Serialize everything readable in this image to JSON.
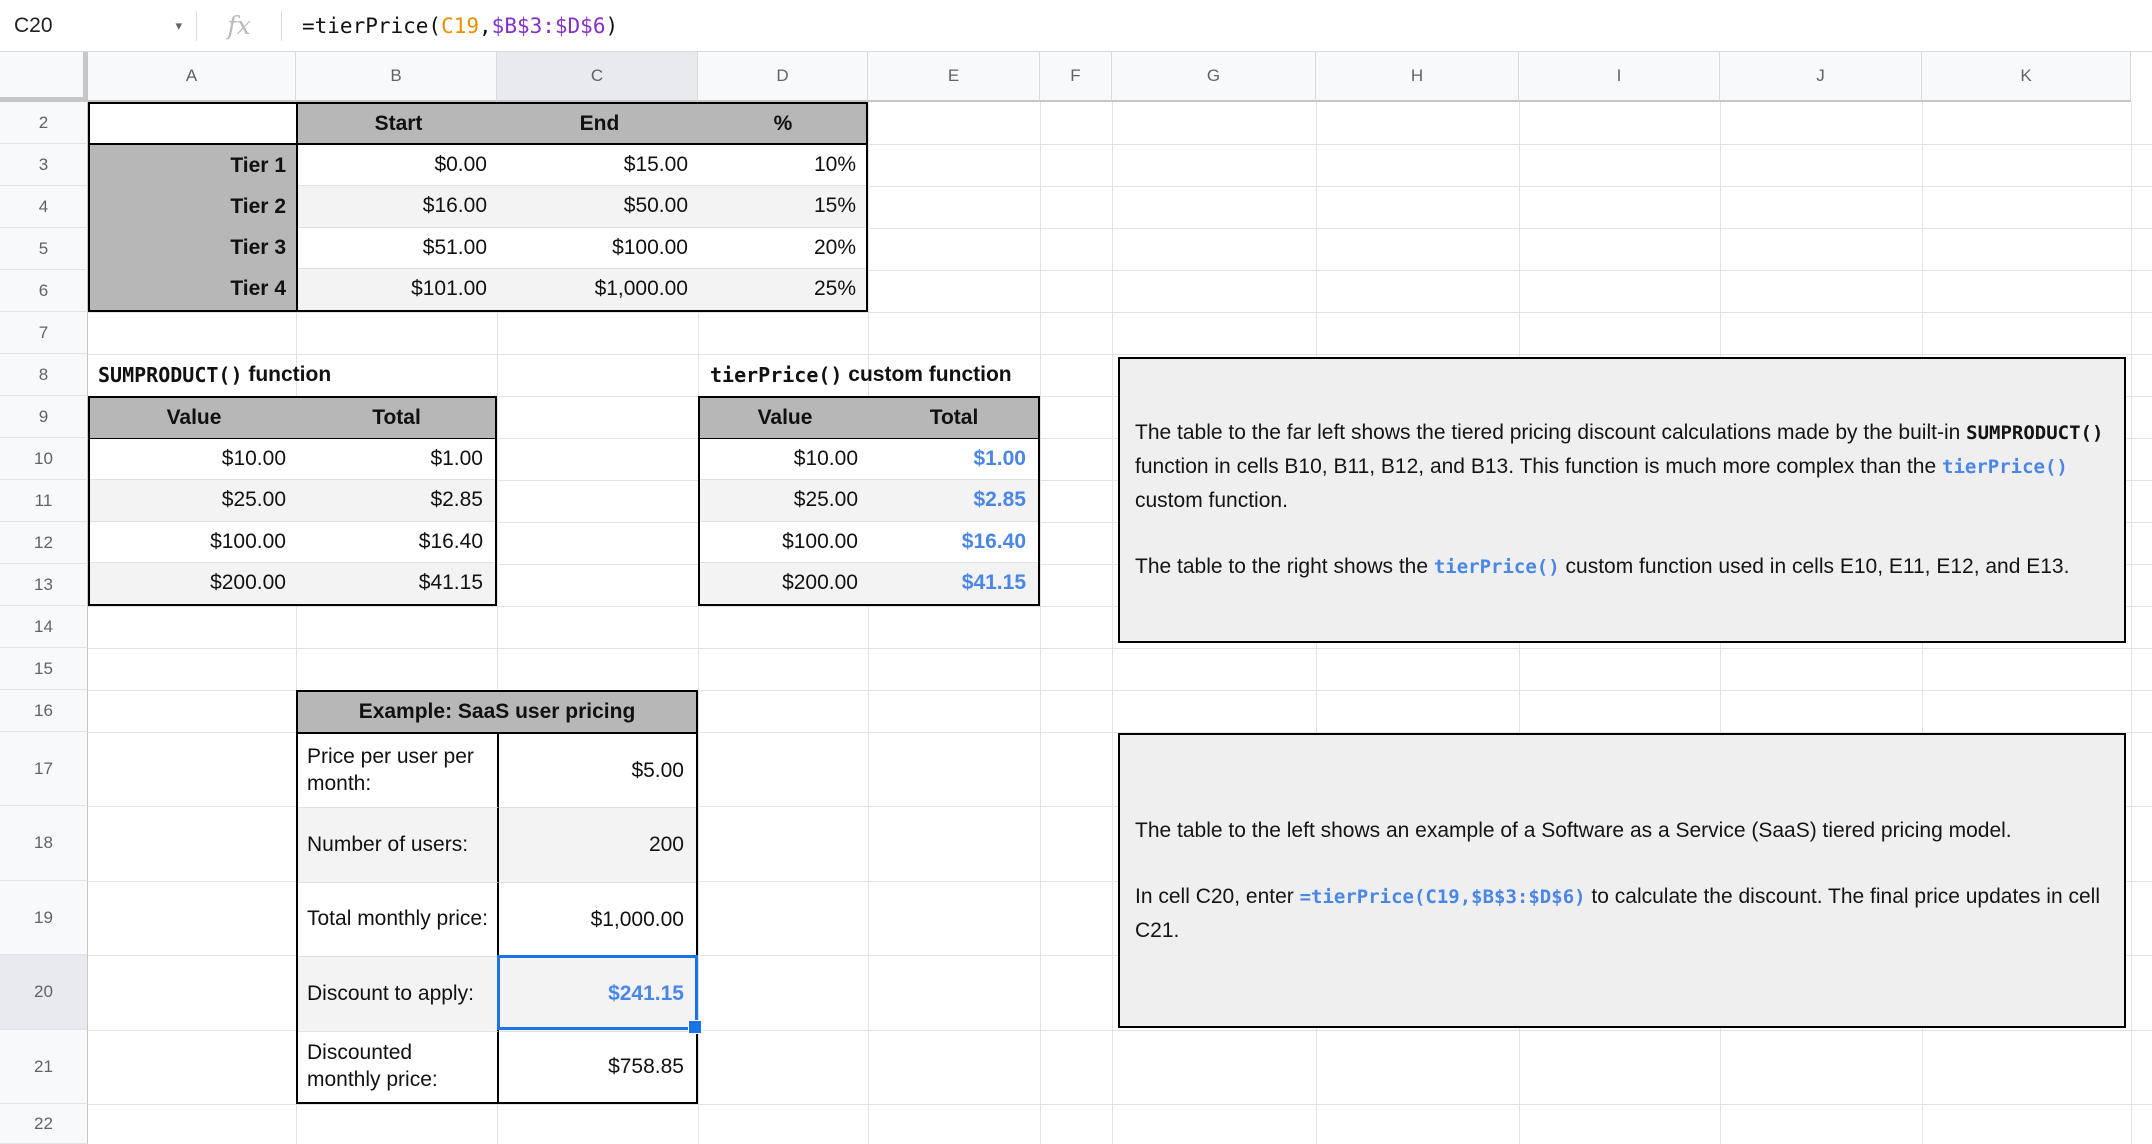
{
  "formula_bar": {
    "cell_ref": "C20",
    "dropdown_icon": "▾",
    "fx_label": "fx",
    "segments": [
      {
        "t": "=tierPrice("
      },
      {
        "t": "C19",
        "s": "orange"
      },
      {
        "t": ","
      },
      {
        "t": "$B$3:$D$6",
        "s": "purple"
      },
      {
        "t": ")"
      }
    ]
  },
  "sheet": {
    "columns": [
      "A",
      "B",
      "C",
      "D",
      "E",
      "F",
      "G",
      "H",
      "I",
      "J",
      "K"
    ],
    "rows": [
      "2",
      "3",
      "4",
      "5",
      "6",
      "7",
      "8",
      "9",
      "10",
      "11",
      "12",
      "13",
      "14",
      "15",
      "16",
      "17",
      "18",
      "19",
      "20",
      "21",
      "22"
    ],
    "selected_column": "C",
    "selected_row": "20"
  },
  "tier_table": {
    "headers": {
      "start": "Start",
      "end": "End",
      "pct": "%"
    },
    "rows": [
      {
        "label": "Tier 1",
        "start": "$0.00",
        "end": "$15.00",
        "pct": "10%"
      },
      {
        "label": "Tier 2",
        "start": "$16.00",
        "end": "$50.00",
        "pct": "15%"
      },
      {
        "label": "Tier 3",
        "start": "$51.00",
        "end": "$100.00",
        "pct": "20%"
      },
      {
        "label": "Tier 4",
        "start": "$101.00",
        "end": "$1,000.00",
        "pct": "25%"
      }
    ]
  },
  "sumproduct_section": {
    "title_code": "SUMPRODUCT()",
    "title_rest": " function",
    "headers": {
      "value": "Value",
      "total": "Total"
    },
    "rows": [
      {
        "value": "$10.00",
        "total": "$1.00"
      },
      {
        "value": "$25.00",
        "total": "$2.85"
      },
      {
        "value": "$100.00",
        "total": "$16.40"
      },
      {
        "value": "$200.00",
        "total": "$41.15"
      }
    ]
  },
  "tierprice_section": {
    "title_code": "tierPrice()",
    "title_rest": " custom function",
    "headers": {
      "value": "Value",
      "total": "Total"
    },
    "rows": [
      {
        "value": "$10.00",
        "total": "$1.00"
      },
      {
        "value": "$25.00",
        "total": "$2.85"
      },
      {
        "value": "$100.00",
        "total": "$16.40"
      },
      {
        "value": "$200.00",
        "total": "$41.15"
      }
    ]
  },
  "saas_table": {
    "title": "Example: SaaS user pricing",
    "rows": [
      {
        "label": "Price per user per month:",
        "value": "$5.00"
      },
      {
        "label": "Number of users:",
        "value": "200"
      },
      {
        "label": "Total monthly price:",
        "value": "$1,000.00"
      },
      {
        "label": "Discount to apply:",
        "value": "$241.15"
      },
      {
        "label": "Discounted monthly price:",
        "value": "$758.85"
      }
    ]
  },
  "note1": {
    "paragraphs": [
      [
        {
          "t": "The table to the far left shows the tiered pricing discount calculations made by the built-in "
        },
        {
          "t": "SUMPRODUCT()",
          "s": "code"
        },
        {
          "t": " function in cells B10, B11, B12, and B13. This function is much more complex than the "
        },
        {
          "t": "tierPrice()",
          "s": "code-blue"
        },
        {
          "t": " custom function."
        }
      ],
      [
        {
          "t": "The table to the right shows the "
        },
        {
          "t": "tierPrice()",
          "s": "code-blue"
        },
        {
          "t": " custom function used in cells E10, E11, E12, and E13."
        }
      ]
    ]
  },
  "note2": {
    "paragraphs": [
      [
        {
          "t": "The table to the left shows an example of a Software as a Service (SaaS) tiered pricing model."
        }
      ],
      [
        {
          "t": "In cell C20, enter "
        },
        {
          "t": "=tierPrice(C19,$B$3:$D$6)",
          "s": "code-blue"
        },
        {
          "t": " to calculate the discount. The final price updates in cell C21."
        }
      ]
    ]
  },
  "colors": {
    "selection_blue": "#1a73e8",
    "value_blue": "#4a86e8",
    "formula_orange": "#ea8f00",
    "formula_purple": "#8430ce",
    "table_header_gray": "#b7b7b7",
    "row_stripe_gray": "#f3f3f3",
    "note_background": "#efefef"
  }
}
